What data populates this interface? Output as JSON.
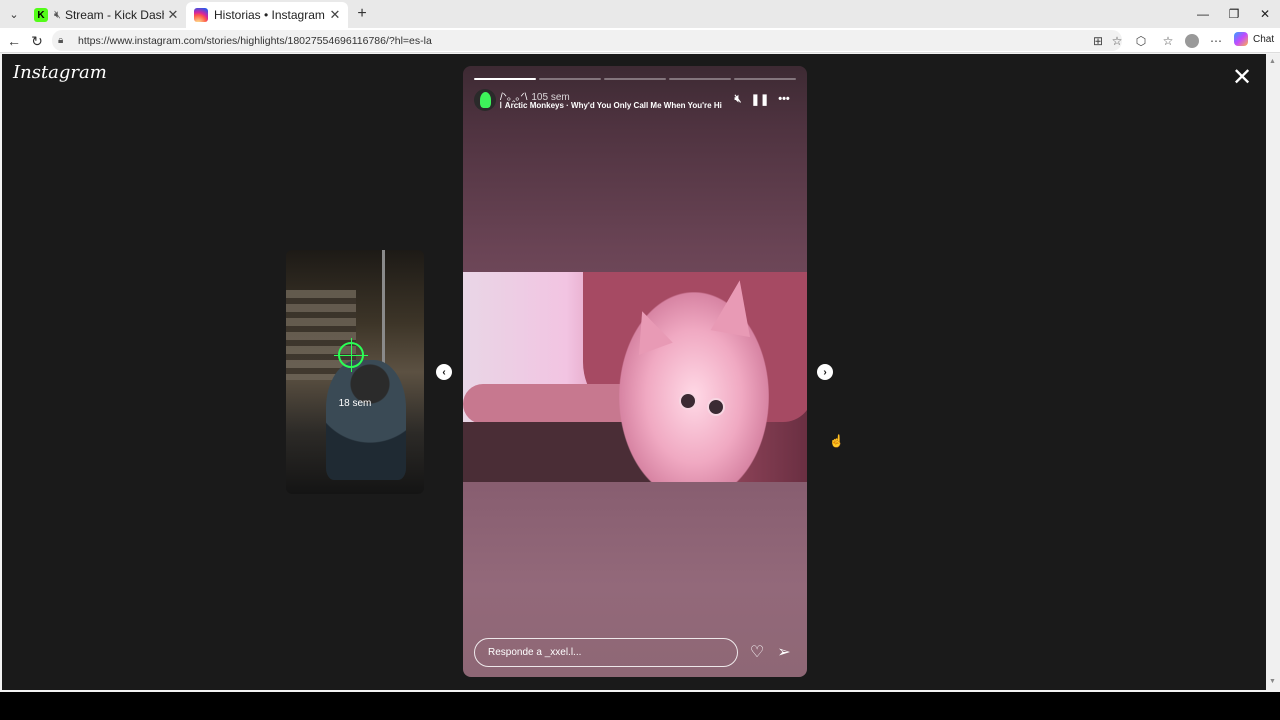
{
  "browser": {
    "tabs": [
      {
        "title": "Stream - Kick Dashboard",
        "icon": "kick-logo-icon",
        "muted": true
      },
      {
        "title": "Historias • Instagram",
        "icon": "instagram-logo-icon",
        "active": true
      }
    ],
    "url": "https://www.instagram.com/stories/highlights/18027554696116786/?hl=es-la",
    "copilot_label": "Chat"
  },
  "page": {
    "logo_text": "Instagram",
    "preview_story": {
      "time": "18 sem"
    },
    "story": {
      "username": "/ᐠ｡ꞈ｡ᐟ\\",
      "time": "105 sem",
      "music": "Arctic Monkeys · Why'd You Only Call Me When You're High?",
      "progress_segments": 5,
      "progress_current": 1,
      "reply_placeholder": "Responde a _xxel.l..."
    }
  },
  "colors": {
    "page_bg": "#1a1a1a",
    "kick_green": "#53fc18",
    "cursor": "#37d6a3"
  }
}
